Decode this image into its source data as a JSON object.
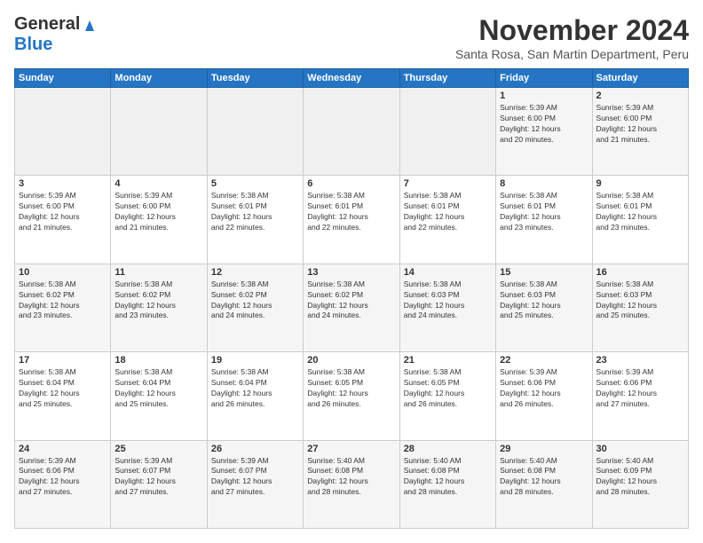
{
  "logo": {
    "line1": "General",
    "line2": "Blue"
  },
  "header": {
    "month": "November 2024",
    "location": "Santa Rosa, San Martin Department, Peru"
  },
  "weekdays": [
    "Sunday",
    "Monday",
    "Tuesday",
    "Wednesday",
    "Thursday",
    "Friday",
    "Saturday"
  ],
  "weeks": [
    [
      {
        "day": "",
        "info": "",
        "empty": true
      },
      {
        "day": "",
        "info": "",
        "empty": true
      },
      {
        "day": "",
        "info": "",
        "empty": true
      },
      {
        "day": "",
        "info": "",
        "empty": true
      },
      {
        "day": "",
        "info": "",
        "empty": true
      },
      {
        "day": "1",
        "info": "Sunrise: 5:39 AM\nSunset: 6:00 PM\nDaylight: 12 hours\nand 20 minutes."
      },
      {
        "day": "2",
        "info": "Sunrise: 5:39 AM\nSunset: 6:00 PM\nDaylight: 12 hours\nand 21 minutes."
      }
    ],
    [
      {
        "day": "3",
        "info": "Sunrise: 5:39 AM\nSunset: 6:00 PM\nDaylight: 12 hours\nand 21 minutes."
      },
      {
        "day": "4",
        "info": "Sunrise: 5:39 AM\nSunset: 6:00 PM\nDaylight: 12 hours\nand 21 minutes."
      },
      {
        "day": "5",
        "info": "Sunrise: 5:38 AM\nSunset: 6:01 PM\nDaylight: 12 hours\nand 22 minutes."
      },
      {
        "day": "6",
        "info": "Sunrise: 5:38 AM\nSunset: 6:01 PM\nDaylight: 12 hours\nand 22 minutes."
      },
      {
        "day": "7",
        "info": "Sunrise: 5:38 AM\nSunset: 6:01 PM\nDaylight: 12 hours\nand 22 minutes."
      },
      {
        "day": "8",
        "info": "Sunrise: 5:38 AM\nSunset: 6:01 PM\nDaylight: 12 hours\nand 23 minutes."
      },
      {
        "day": "9",
        "info": "Sunrise: 5:38 AM\nSunset: 6:01 PM\nDaylight: 12 hours\nand 23 minutes."
      }
    ],
    [
      {
        "day": "10",
        "info": "Sunrise: 5:38 AM\nSunset: 6:02 PM\nDaylight: 12 hours\nand 23 minutes."
      },
      {
        "day": "11",
        "info": "Sunrise: 5:38 AM\nSunset: 6:02 PM\nDaylight: 12 hours\nand 23 minutes."
      },
      {
        "day": "12",
        "info": "Sunrise: 5:38 AM\nSunset: 6:02 PM\nDaylight: 12 hours\nand 24 minutes."
      },
      {
        "day": "13",
        "info": "Sunrise: 5:38 AM\nSunset: 6:02 PM\nDaylight: 12 hours\nand 24 minutes."
      },
      {
        "day": "14",
        "info": "Sunrise: 5:38 AM\nSunset: 6:03 PM\nDaylight: 12 hours\nand 24 minutes."
      },
      {
        "day": "15",
        "info": "Sunrise: 5:38 AM\nSunset: 6:03 PM\nDaylight: 12 hours\nand 25 minutes."
      },
      {
        "day": "16",
        "info": "Sunrise: 5:38 AM\nSunset: 6:03 PM\nDaylight: 12 hours\nand 25 minutes."
      }
    ],
    [
      {
        "day": "17",
        "info": "Sunrise: 5:38 AM\nSunset: 6:04 PM\nDaylight: 12 hours\nand 25 minutes."
      },
      {
        "day": "18",
        "info": "Sunrise: 5:38 AM\nSunset: 6:04 PM\nDaylight: 12 hours\nand 25 minutes."
      },
      {
        "day": "19",
        "info": "Sunrise: 5:38 AM\nSunset: 6:04 PM\nDaylight: 12 hours\nand 26 minutes."
      },
      {
        "day": "20",
        "info": "Sunrise: 5:38 AM\nSunset: 6:05 PM\nDaylight: 12 hours\nand 26 minutes."
      },
      {
        "day": "21",
        "info": "Sunrise: 5:38 AM\nSunset: 6:05 PM\nDaylight: 12 hours\nand 26 minutes."
      },
      {
        "day": "22",
        "info": "Sunrise: 5:39 AM\nSunset: 6:06 PM\nDaylight: 12 hours\nand 26 minutes."
      },
      {
        "day": "23",
        "info": "Sunrise: 5:39 AM\nSunset: 6:06 PM\nDaylight: 12 hours\nand 27 minutes."
      }
    ],
    [
      {
        "day": "24",
        "info": "Sunrise: 5:39 AM\nSunset: 6:06 PM\nDaylight: 12 hours\nand 27 minutes."
      },
      {
        "day": "25",
        "info": "Sunrise: 5:39 AM\nSunset: 6:07 PM\nDaylight: 12 hours\nand 27 minutes."
      },
      {
        "day": "26",
        "info": "Sunrise: 5:39 AM\nSunset: 6:07 PM\nDaylight: 12 hours\nand 27 minutes."
      },
      {
        "day": "27",
        "info": "Sunrise: 5:40 AM\nSunset: 6:08 PM\nDaylight: 12 hours\nand 28 minutes."
      },
      {
        "day": "28",
        "info": "Sunrise: 5:40 AM\nSunset: 6:08 PM\nDaylight: 12 hours\nand 28 minutes."
      },
      {
        "day": "29",
        "info": "Sunrise: 5:40 AM\nSunset: 6:08 PM\nDaylight: 12 hours\nand 28 minutes."
      },
      {
        "day": "30",
        "info": "Sunrise: 5:40 AM\nSunset: 6:09 PM\nDaylight: 12 hours\nand 28 minutes."
      }
    ]
  ]
}
